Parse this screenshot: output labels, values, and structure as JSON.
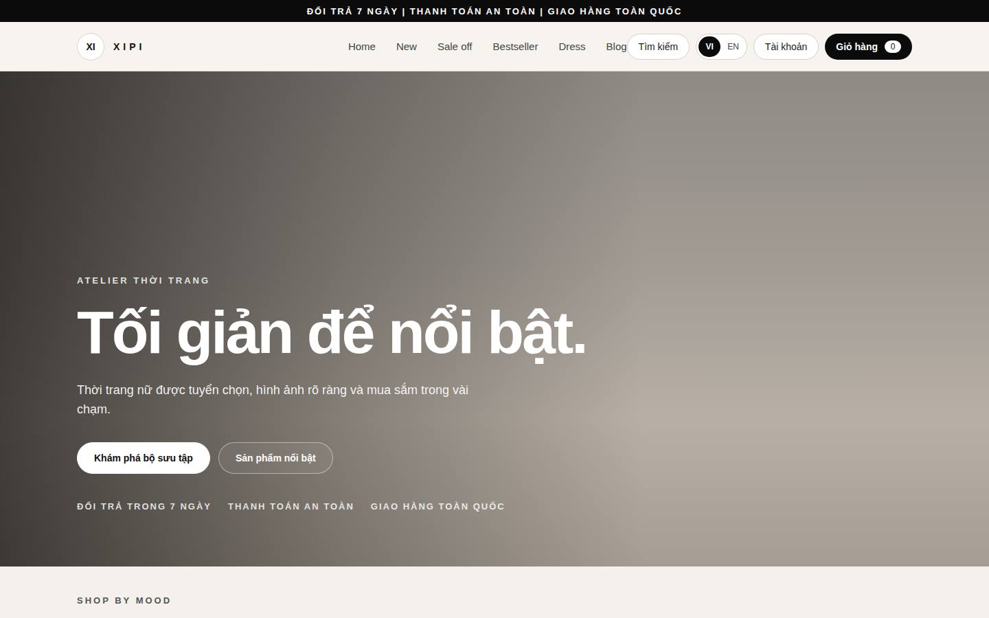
{
  "announcement": {
    "text": "ĐỔI TRẢ 7 NGÀY | THANH TOÁN AN TOÀN | GIAO HÀNG TOÀN QUỐC"
  },
  "header": {
    "logo": {
      "mark": "XI",
      "name": "XIPI"
    },
    "nav": [
      "Home",
      "New",
      "Sale off",
      "Bestseller",
      "Dress",
      "Blog"
    ],
    "search": "Tìm kiếm",
    "languages": [
      {
        "label": "VI",
        "selected": true
      },
      {
        "label": "EN",
        "selected": false
      }
    ],
    "account": "Tài khoản",
    "cart": {
      "label": "Giỏ hàng",
      "count": "0"
    }
  },
  "hero": {
    "eyebrow": "ATELIER THỜI TRANG",
    "title": "Tối giản để nổi bật.",
    "subtitle": "Thời trang nữ được tuyển chọn, hình ảnh rõ ràng và mua sắm trong vài chạm.",
    "buttons": [
      {
        "label": "Khám phá bộ sưu tập",
        "kind": "primary"
      },
      {
        "label": "Sản phẩm nổi bật",
        "kind": "outline"
      }
    ],
    "perks": [
      "ĐỔI TRẢ TRONG 7 NGÀY",
      "THANH TOÁN AN TOÀN",
      "GIAO HÀNG TOÀN QUỐC"
    ]
  },
  "mood_section": {
    "eyebrow": "SHOP BY MOOD"
  }
}
